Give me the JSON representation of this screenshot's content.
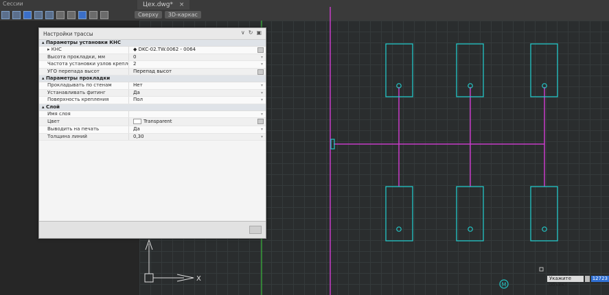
{
  "app": {
    "title": "Сессии",
    "tab_title": "Цех.dwg*",
    "tab_close": "×"
  },
  "views": [
    "Сверху",
    "3D-каркас"
  ],
  "panel": {
    "title": "Настройки трассы",
    "controls": {
      "menu": "∨",
      "refresh": "↻",
      "pin": "▣"
    },
    "groups": [
      {
        "label": "Параметры установки КНС",
        "rows": [
          {
            "key": "КНС",
            "value": "DKC-02.TW.0062 - 0064"
          },
          {
            "key": "Высота прокладки, мм",
            "value": "0"
          },
          {
            "key": "Частота установки узлов крепления,...",
            "value": "2"
          },
          {
            "key": "УГО перепада высот",
            "value": "Перепад высот"
          }
        ]
      },
      {
        "label": "Параметры прокладки",
        "rows": [
          {
            "key": "Прокладывать по стенам",
            "value": "Нет"
          },
          {
            "key": "Устанавливать фитинг",
            "value": "Да"
          },
          {
            "key": "Поверхность крепления",
            "value": "Пол"
          }
        ]
      },
      {
        "label": "Слой",
        "rows": [
          {
            "key": "Имя слоя",
            "value": ""
          },
          {
            "key": "Цвет",
            "value": "Transparent"
          },
          {
            "key": "Выводить на печать",
            "value": "Да"
          },
          {
            "key": "Толщина линий",
            "value": "0,30"
          }
        ]
      }
    ]
  },
  "canvas": {
    "ucs_x_label": "X",
    "marker_label": "M",
    "colors": {
      "cyan": "#22c7c7",
      "magenta": "#c83cc8",
      "green": "#3cd23c"
    }
  },
  "status": {
    "prompt": "Укажите объект",
    "value": "12723"
  }
}
